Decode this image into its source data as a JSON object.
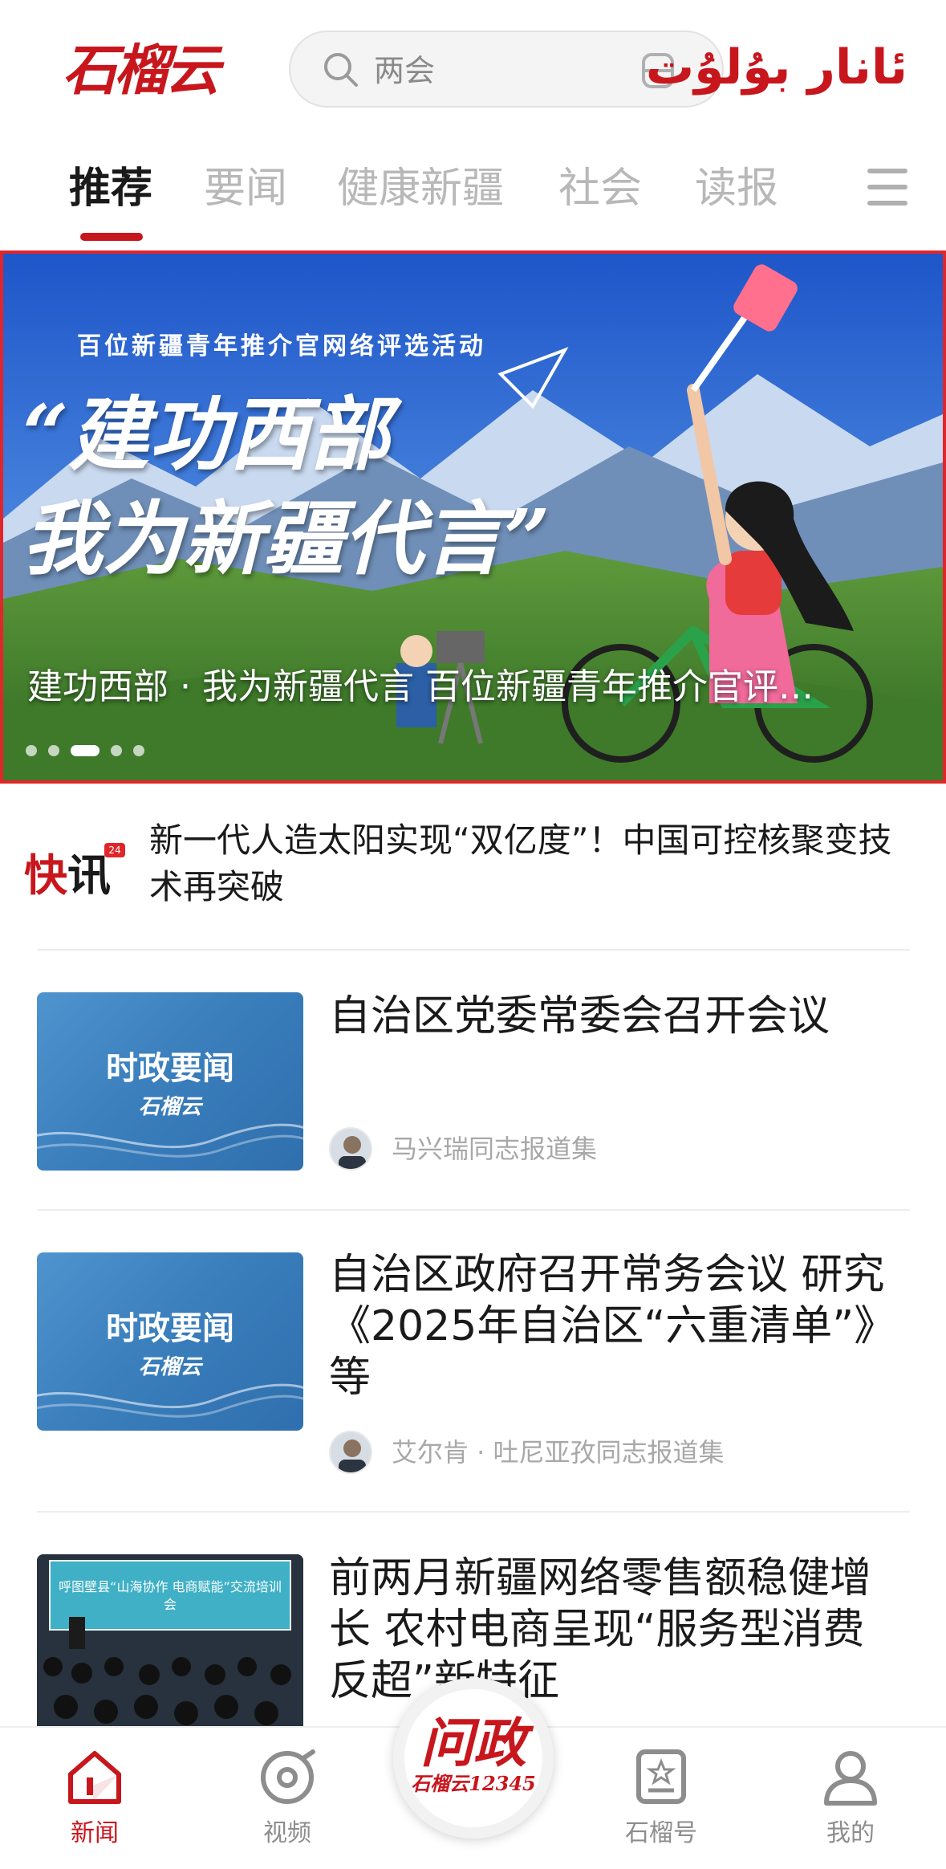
{
  "header": {
    "logo_cn": "石榴云",
    "search_placeholder": "两会",
    "logo_ug": "ئانار بۇلۇت"
  },
  "tabs": [
    {
      "label": "推荐",
      "active": true
    },
    {
      "label": "要闻"
    },
    {
      "label": "健康新疆"
    },
    {
      "label": "社会"
    },
    {
      "label": "读报"
    }
  ],
  "banner": {
    "subtitle": "百位新疆青年推介官网络评选活动",
    "title_line1": "“建功西部",
    "title_line2": "我为新疆代言”",
    "caption": "建功西部 · 我为新疆代言 百位新疆青年推介官评…",
    "dots": 5,
    "active_dot": 3
  },
  "flash": {
    "label_hi": "快",
    "label_rest": "讯",
    "badge": "24",
    "text": "新一代人造太阳实现“双亿度”！中国可控核聚变技术再突破"
  },
  "news": [
    {
      "thumb_title": "时政要闻",
      "thumb_logo": "石榴云",
      "title": "自治区党委常委会召开会议",
      "author": "马兴瑞同志报道集"
    },
    {
      "thumb_title": "时政要闻",
      "thumb_logo": "石榴云",
      "title": "自治区政府召开常务会议 研究《2025年自治区“六重清单”》等",
      "author": "艾尔肯 · 吐尼亚孜同志报道集"
    },
    {
      "thumb_caption": "呼图壁县“山海协作 电商赋能”交流培训会",
      "title": "前两月新疆网络零售额稳健增长 农村电商呈现“服务型消费反超”新特征"
    }
  ],
  "bottom_nav": {
    "items": [
      {
        "label": "新闻",
        "icon": "home-icon",
        "active": true
      },
      {
        "label": "视频",
        "icon": "video-icon"
      },
      {
        "label": "石榴号",
        "icon": "account-icon"
      },
      {
        "label": "我的",
        "icon": "user-icon"
      }
    ],
    "center": {
      "big": "问政",
      "small": "石榴云12345"
    }
  },
  "colors": {
    "brand": "#c8161d",
    "muted": "#b8b8b8"
  }
}
